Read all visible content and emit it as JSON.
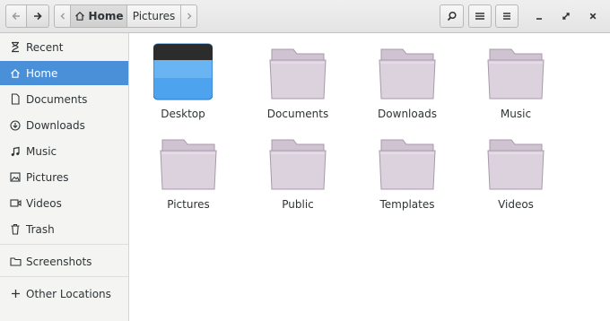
{
  "nav": {
    "back_icon": "arrow-left-icon",
    "forward_icon": "arrow-right-icon"
  },
  "pathbar": {
    "home_label": "Home",
    "current_label": "Pictures"
  },
  "toolbar": {
    "search_icon": "search-icon",
    "view_icon": "list-view-icon",
    "menu_icon": "menu-icon"
  },
  "window": {
    "minimize_icon": "minimize-icon",
    "maximize_icon": "maximize-icon",
    "close_icon": "close-icon"
  },
  "sidebar": {
    "items": [
      {
        "label": "Recent",
        "icon": "recent-icon"
      },
      {
        "label": "Home",
        "icon": "home-icon"
      },
      {
        "label": "Documents",
        "icon": "document-icon"
      },
      {
        "label": "Downloads",
        "icon": "download-icon"
      },
      {
        "label": "Music",
        "icon": "music-icon"
      },
      {
        "label": "Pictures",
        "icon": "pictures-icon"
      },
      {
        "label": "Videos",
        "icon": "video-icon"
      },
      {
        "label": "Trash",
        "icon": "trash-icon"
      },
      {
        "label": "Screenshots",
        "icon": "folder-icon"
      },
      {
        "label": "Other Locations",
        "icon": "plus-icon"
      }
    ]
  },
  "files": [
    {
      "label": "Desktop",
      "icon": "desktop-folder-icon"
    },
    {
      "label": "Documents",
      "icon": "folder-icon"
    },
    {
      "label": "Downloads",
      "icon": "folder-icon"
    },
    {
      "label": "Music",
      "icon": "folder-icon"
    },
    {
      "label": "Pictures",
      "icon": "folder-icon"
    },
    {
      "label": "Public",
      "icon": "folder-icon"
    },
    {
      "label": "Templates",
      "icon": "folder-icon"
    },
    {
      "label": "Videos",
      "icon": "folder-icon"
    }
  ],
  "colors": {
    "accent": "#4a90d9",
    "folder": "#dcd2de",
    "desktop_top": "#2c2c2c",
    "desktop_fill": "#4ea3ef"
  }
}
